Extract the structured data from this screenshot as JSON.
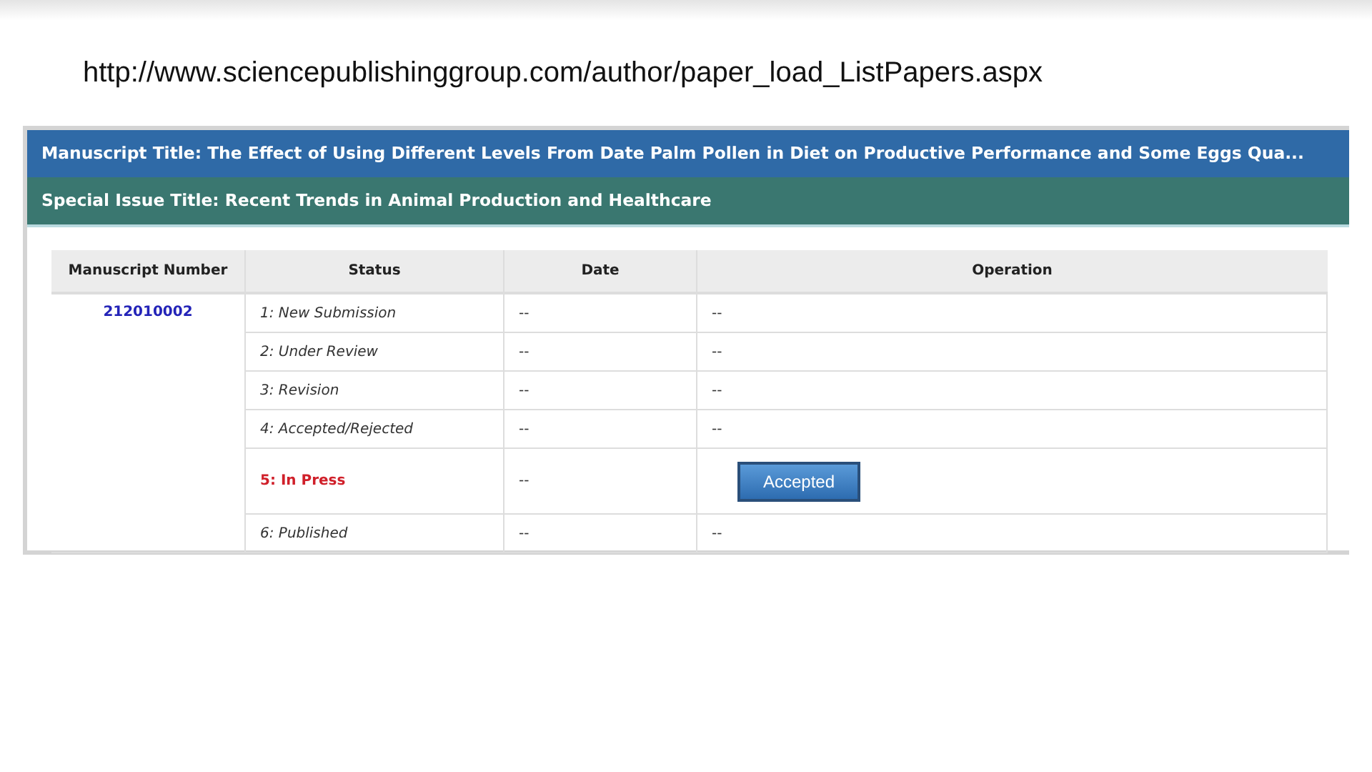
{
  "slide": {
    "url": "http://www.sciencepublishinggroup.com/author/paper_load_ListPapers.aspx"
  },
  "panel": {
    "manuscript_title": "Manuscript Title: The Effect of Using Different Levels From Date Palm Pollen in Diet on Productive Performance and Some Eggs Qua...",
    "special_issue_title": "Special Issue Title: Recent Trends in Animal Production and Healthcare"
  },
  "table": {
    "columns": [
      "Manuscript Number",
      "Status",
      "Date",
      "Operation"
    ],
    "manuscript_number": "212010002",
    "rows": [
      {
        "status": "1: New Submission",
        "current": false,
        "date": "--",
        "operation": {
          "kind": "text",
          "text": "--"
        }
      },
      {
        "status": "2: Under Review",
        "current": false,
        "date": "--",
        "operation": {
          "kind": "text",
          "text": "--"
        }
      },
      {
        "status": "3: Revision",
        "current": false,
        "date": "--",
        "operation": {
          "kind": "text",
          "text": "--"
        }
      },
      {
        "status": "4: Accepted/Rejected",
        "current": false,
        "date": "--",
        "operation": {
          "kind": "text",
          "text": "--"
        }
      },
      {
        "status": "5: In Press",
        "current": true,
        "date": "--",
        "operation": {
          "kind": "button",
          "label": "Accepted"
        }
      },
      {
        "status": "6: Published",
        "current": false,
        "date": "--",
        "operation": {
          "kind": "text",
          "text": "--"
        }
      }
    ]
  }
}
